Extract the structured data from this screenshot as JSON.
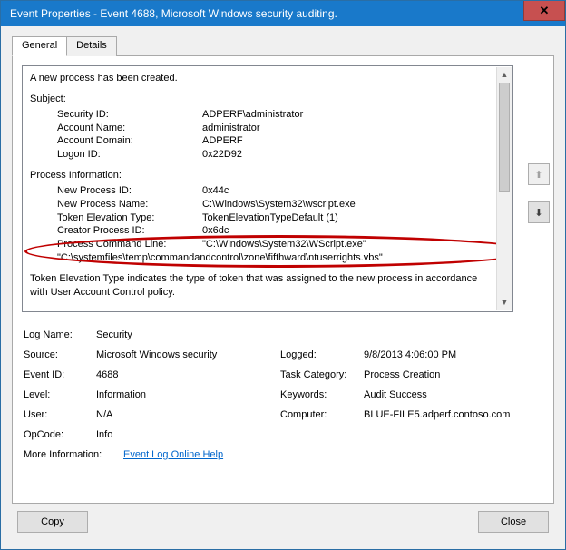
{
  "window": {
    "title": "Event Properties - Event 4688, Microsoft Windows security auditing.",
    "close_glyph": "✕"
  },
  "tabs": {
    "general": "General",
    "details": "Details"
  },
  "desc": {
    "heading": "A new process has been created.",
    "subject_head": "Subject:",
    "subject": {
      "sid_k": "Security ID:",
      "sid_v": "ADPERF\\administrator",
      "acct_k": "Account Name:",
      "acct_v": "administrator",
      "dom_k": "Account Domain:",
      "dom_v": "ADPERF",
      "logon_k": "Logon ID:",
      "logon_v": "0x22D92"
    },
    "proc_head": "Process Information:",
    "proc": {
      "npid_k": "New Process ID:",
      "npid_v": "0x44c",
      "npname_k": "New Process Name:",
      "npname_v": "C:\\Windows\\System32\\wscript.exe",
      "tet_k": "Token Elevation Type:",
      "tet_v": "TokenElevationTypeDefault (1)",
      "cpid_k": "Creator Process ID:",
      "cpid_v": "0x6dc",
      "cmd_k": "Process Command Line:",
      "cmd_v": "\"C:\\Windows\\System32\\WScript.exe\" \"C:\\systemfiles\\temp\\commandandcontrol\\zone\\fifthward\\ntuserrights.vbs\""
    },
    "footer": "Token Elevation Type indicates the type of token that was assigned to the new process in accordance with User Account Control policy."
  },
  "summary": {
    "logname_k": "Log Name:",
    "logname_v": "Security",
    "source_k": "Source:",
    "source_v": "Microsoft Windows security",
    "logged_k": "Logged:",
    "logged_v": "9/8/2013 4:06:00 PM",
    "eventid_k": "Event ID:",
    "eventid_v": "4688",
    "taskcat_k": "Task Category:",
    "taskcat_v": "Process Creation",
    "level_k": "Level:",
    "level_v": "Information",
    "keywords_k": "Keywords:",
    "keywords_v": "Audit Success",
    "user_k": "User:",
    "user_v": "N/A",
    "computer_k": "Computer:",
    "computer_v": "BLUE-FILE5.adperf.contoso.com",
    "opcode_k": "OpCode:",
    "opcode_v": "Info",
    "moreinfo_k": "More Information:",
    "moreinfo_v": "Event Log Online Help"
  },
  "buttons": {
    "copy": "Copy",
    "close": "Close"
  },
  "nav": {
    "up": "⬆",
    "down": "⬇"
  }
}
